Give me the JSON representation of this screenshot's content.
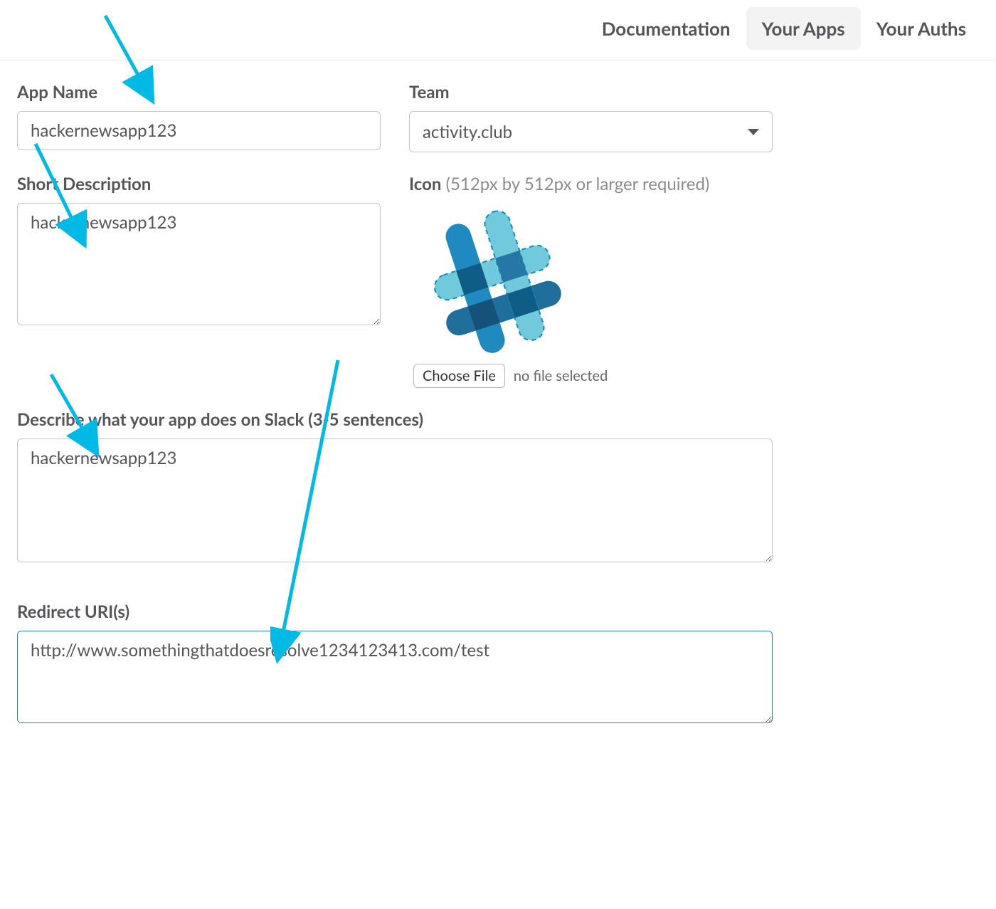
{
  "nav": {
    "documentation": "Documentation",
    "your_apps": "Your Apps",
    "your_auths": "Your Auths"
  },
  "labels": {
    "app_name": "App Name",
    "team": "Team",
    "short_desc": "Short Description",
    "icon": "Icon",
    "icon_hint": " (512px by 512px or larger required)",
    "long_desc": "Describe what your app does on Slack (3-5 sentences)",
    "redirect": "Redirect URI(s)",
    "choose_file": "Choose File",
    "no_file": "no file selected"
  },
  "values": {
    "app_name": "hackernewsapp123",
    "team": "activity.club",
    "short_desc": "hackernewsapp123",
    "long_desc": "hackernewsapp123",
    "redirect": "http://www.somethingthatdoesresolve1234123413.com/test"
  },
  "annotation_color": "#00b9e4"
}
